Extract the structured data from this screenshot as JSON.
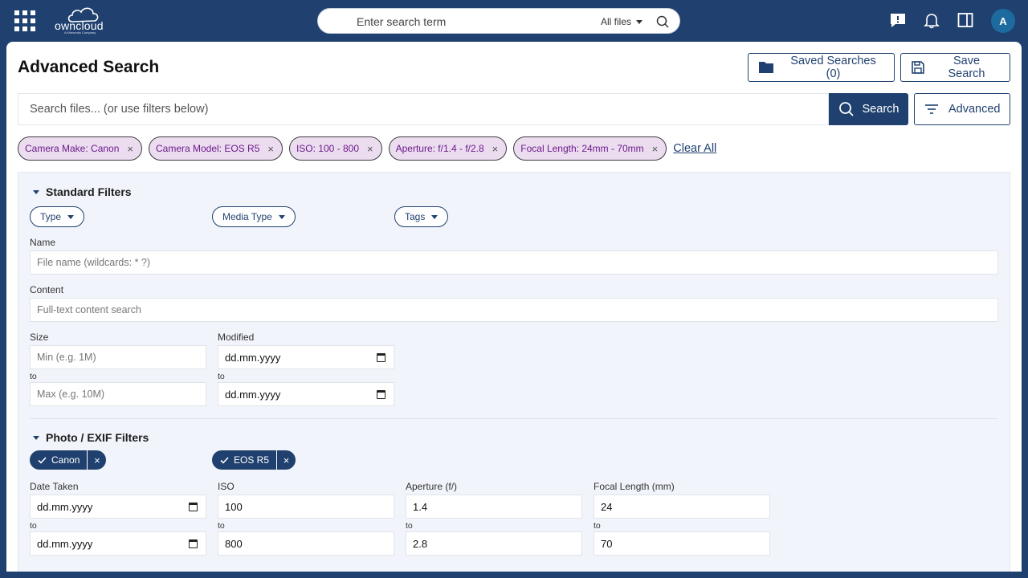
{
  "topbar": {
    "logo_text": "owncloud",
    "logo_sub": "A Kiteworks Company",
    "search_placeholder": "Enter search term",
    "scope_label": "All files",
    "avatar_initial": "A"
  },
  "page": {
    "title": "Advanced Search",
    "saved_searches_label": "Saved Searches (0)",
    "save_search_label": "Save Search",
    "search_placeholder": "Search files... (or use filters below)",
    "search_button": "Search",
    "advanced_button": "Advanced"
  },
  "active_filters": [
    {
      "label": "Camera Make: Canon"
    },
    {
      "label": "Camera Model: EOS R5"
    },
    {
      "label": "ISO: 100 - 800"
    },
    {
      "label": "Aperture: f/1.4 - f/2.8"
    },
    {
      "label": "Focal Length: 24mm - 70mm"
    }
  ],
  "clear_all_label": "Clear All",
  "chip_close_glyph": "×",
  "standard": {
    "title": "Standard Filters",
    "dropdowns": [
      "Type",
      "Media Type",
      "Tags"
    ],
    "name_label": "Name",
    "name_placeholder": "File name (wildcards: * ?)",
    "content_label": "Content",
    "content_placeholder": "Full-text content search",
    "size_label": "Size",
    "size_min_placeholder": "Min (e.g. 1M)",
    "size_max_placeholder": "Max (e.g. 10M)",
    "modified_label": "Modified",
    "date_placeholder": "dd.mm.yyyy",
    "to_label": "to"
  },
  "exif": {
    "title": "Photo / EXIF Filters",
    "make_chip": "Canon",
    "model_chip": "EOS R5",
    "date_taken_label": "Date Taken",
    "iso_label": "ISO",
    "iso_min": "100",
    "iso_max": "800",
    "aperture_label": "Aperture (f/)",
    "aperture_min": "1.4",
    "aperture_max": "2.8",
    "focal_label": "Focal Length (mm)",
    "focal_min": "24",
    "focal_max": "70"
  },
  "colors": {
    "brand": "#20416f",
    "chip_bg": "#ecdcf0",
    "chip_text": "#6a1b8a",
    "panel_bg": "#f1f4fa",
    "avatar": "#1d6a9f"
  }
}
